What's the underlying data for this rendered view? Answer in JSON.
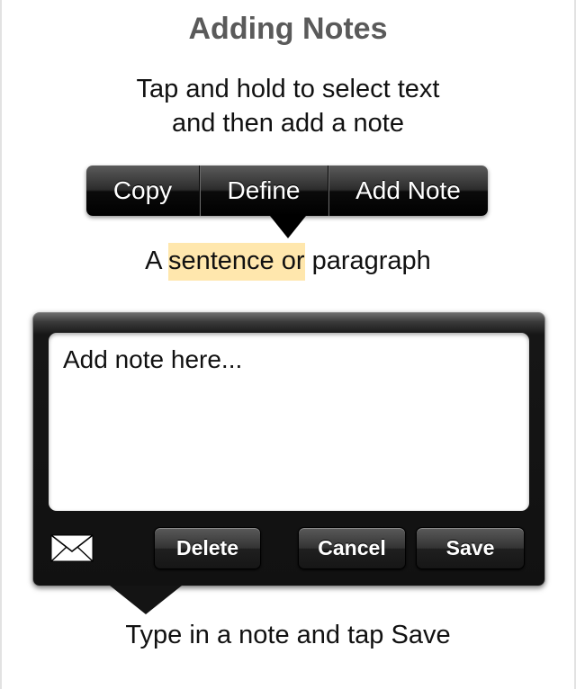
{
  "header": {
    "title": "Adding Notes"
  },
  "instruction": {
    "line1": "Tap and hold to select text",
    "line2": "and then add a note"
  },
  "context_menu": {
    "items": [
      {
        "label": "Copy"
      },
      {
        "label": "Define"
      },
      {
        "label": "Add Note"
      }
    ]
  },
  "sample_text": {
    "before": "A ",
    "highlighted": "sentence or",
    "after": " paragraph",
    "highlight_color": "#ffe7ad"
  },
  "note_editor": {
    "placeholder": "Add note here...",
    "share_icon": "mail-icon",
    "buttons": {
      "delete": "Delete",
      "cancel": "Cancel",
      "save": "Save"
    }
  },
  "caption": "Type in a note and tap Save"
}
